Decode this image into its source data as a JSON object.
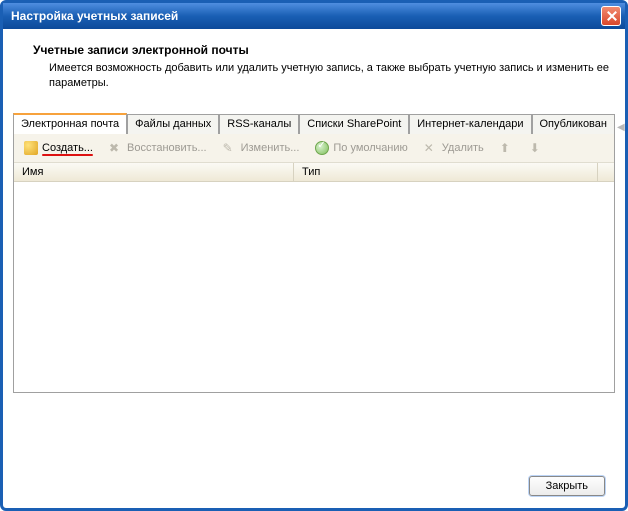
{
  "window": {
    "title": "Настройка учетных записей"
  },
  "header": {
    "title": "Учетные записи электронной почты",
    "description": "Имеется возможность добавить или удалить учетную запись, а также выбрать учетную запись и изменить ее параметры."
  },
  "tabs": [
    {
      "label": "Электронная почта",
      "active": true
    },
    {
      "label": "Файлы данных"
    },
    {
      "label": "RSS-каналы"
    },
    {
      "label": "Списки SharePoint"
    },
    {
      "label": "Интернет-календари"
    },
    {
      "label": "Опубликован"
    }
  ],
  "toolbar": {
    "new": "Создать...",
    "repair": "Восстановить...",
    "edit": "Изменить...",
    "default": "По умолчанию",
    "delete": "Удалить"
  },
  "columns": {
    "name": "Имя",
    "type": "Тип"
  },
  "footer": {
    "close": "Закрыть"
  }
}
